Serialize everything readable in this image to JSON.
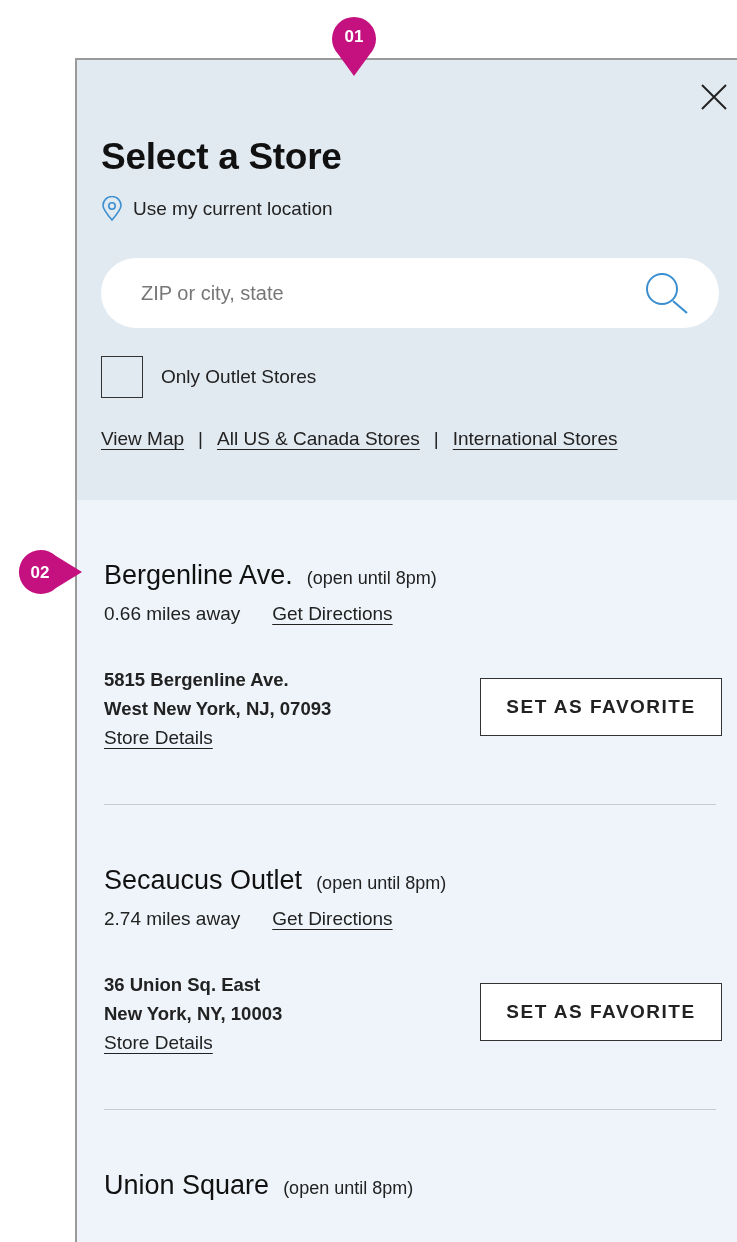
{
  "annotations": [
    {
      "label": "01",
      "kind": "down"
    },
    {
      "label": "02",
      "kind": "right"
    }
  ],
  "panel": {
    "title": "Select a Store",
    "location_link": "Use my current location",
    "search": {
      "placeholder": "ZIP or city, state"
    },
    "outlet_filter": {
      "label": "Only Outlet Stores",
      "checked": false
    },
    "links": [
      "View Map",
      "All US & Canada Stores",
      "International Stores"
    ],
    "separator": "|"
  },
  "stores": [
    {
      "name": "Bergenline Ave.",
      "hours": "(open until 8pm)",
      "distance": "0.66 miles away",
      "directions": "Get Directions",
      "address": [
        "5815 Bergenline Ave.",
        "West New York, NJ, 07093"
      ],
      "details": "Store Details",
      "button": "SET AS FAVORITE"
    },
    {
      "name": "Secaucus Outlet",
      "hours": "(open until 8pm)",
      "distance": "2.74 miles away",
      "directions": "Get Directions",
      "address": [
        "36 Union Sq. East",
        "New York, NY, 10003"
      ],
      "details": "Store Details",
      "button": "SET AS FAVORITE"
    },
    {
      "name": "Union Square",
      "hours": "(open until 8pm)"
    }
  ]
}
